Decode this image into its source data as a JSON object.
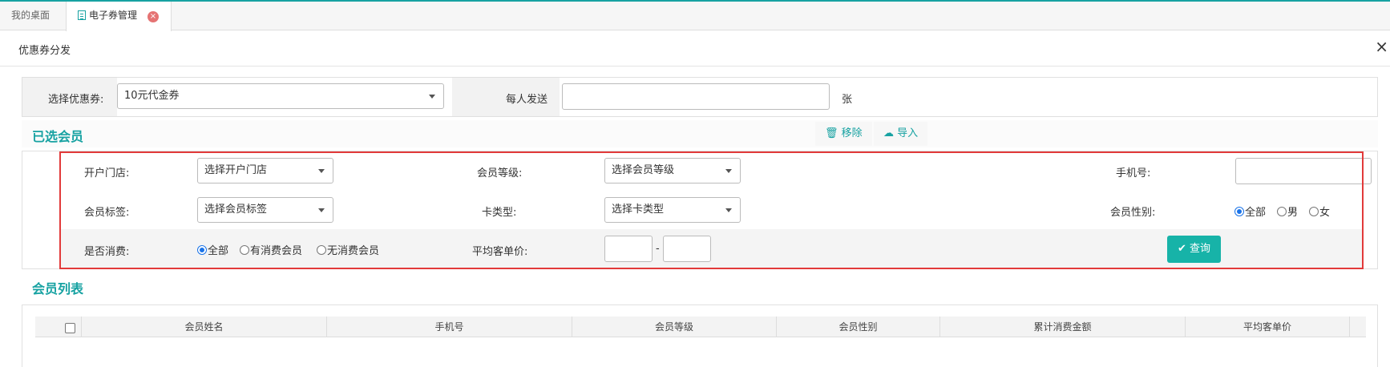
{
  "tabs": [
    {
      "label": "我的桌面"
    },
    {
      "label": "电子券管理",
      "close": "×"
    }
  ],
  "panel": {
    "title": "优惠券分发",
    "close": "×"
  },
  "coupon": {
    "select_label": "选择优惠券:",
    "select_value": "10元代金券",
    "per_person_label": "每人发送",
    "per_person_value": "",
    "unit": "张"
  },
  "selected_members": {
    "title": "已选会员",
    "remove_label": "移除",
    "import_label": "导入"
  },
  "filters": {
    "store_label": "开户门店:",
    "store_value": "选择开户门店",
    "level_label": "会员等级:",
    "level_value": "选择会员等级",
    "phone_label": "手机号:",
    "phone_value": "",
    "tag_label": "会员标签:",
    "tag_value": "选择会员标签",
    "card_type_label": "卡类型:",
    "card_type_value": "选择卡类型",
    "gender_label": "会员性别:",
    "gender_options": [
      "全部",
      "男",
      "女"
    ],
    "consume_label": "是否消费:",
    "consume_options": [
      "全部",
      "有消费会员",
      "无消费会员"
    ],
    "avg_price_label": "平均客单价:",
    "range_sep": "-",
    "query_label": "查询"
  },
  "member_list": {
    "title": "会员列表",
    "columns": [
      "会员姓名",
      "手机号",
      "会员等级",
      "会员性别",
      "累计消费金额",
      "平均客单价"
    ]
  },
  "colors": {
    "accent": "#17a2a2",
    "button": "#17b3a8",
    "highlight_box": "#e23a3a"
  }
}
